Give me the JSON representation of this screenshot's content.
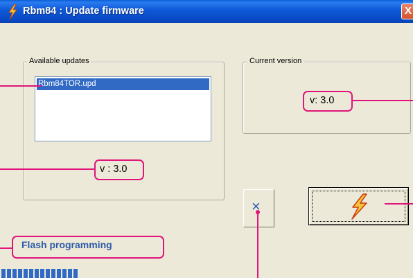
{
  "window": {
    "title": "Rbm84 : Update firmware",
    "close_glyph": "X",
    "title_icon": "lightning-bolt-icon"
  },
  "available_updates": {
    "label": "Available updates",
    "items": [
      "Rbm84TOR.upd"
    ],
    "selected_index": 0,
    "version_text": "v : 3.0"
  },
  "current_version": {
    "label": "Current version",
    "version_text": "v: 3.0"
  },
  "buttons": {
    "cancel_glyph": "×",
    "cancel_icon": "x-icon",
    "flash_icon": "lightning-bolt-icon"
  },
  "status": {
    "text": "Flash programming"
  },
  "progress": {
    "fraction": 0.44
  },
  "colors": {
    "callout": "#e0147a",
    "selection": "#316ac5",
    "status_text": "#2d5aa8",
    "progress": "#316ac5"
  }
}
